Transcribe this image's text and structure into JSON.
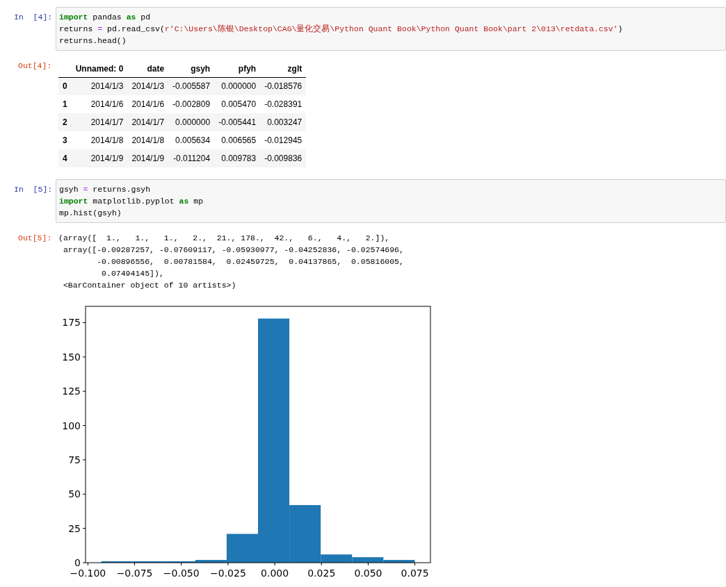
{
  "cells": [
    {
      "in_prompt": "In  [4]:",
      "code": [
        [
          {
            "kind": "keyword",
            "text": "import"
          },
          {
            "kind": "plain",
            "text": " pandas "
          },
          {
            "kind": "keyword",
            "text": "as"
          },
          {
            "kind": "plain",
            "text": " pd"
          }
        ],
        [
          {
            "kind": "plain",
            "text": "returns "
          },
          {
            "kind": "operator",
            "text": "="
          },
          {
            "kind": "plain",
            "text": " pd.read_csv("
          },
          {
            "kind": "string",
            "text": "r'C:\\Users\\陈银\\Desktop\\CAG\\量化交易\\Python Quant Book\\Python Quant Book\\part 2\\013\\retdata.csv'"
          },
          {
            "kind": "plain",
            "text": ")"
          }
        ],
        [
          {
            "kind": "plain",
            "text": "returns.head()"
          }
        ]
      ],
      "out_prompt": "Out[4]:",
      "output": {
        "kind": "table",
        "columns": [
          "",
          "Unnamed: 0",
          "date",
          "gsyh",
          "pfyh",
          "zglt"
        ],
        "rows": [
          [
            "0",
            "2014/1/3",
            "2014/1/3",
            "-0.005587",
            "0.000000",
            "-0.018576"
          ],
          [
            "1",
            "2014/1/6",
            "2014/1/6",
            "-0.002809",
            "0.005470",
            "-0.028391"
          ],
          [
            "2",
            "2014/1/7",
            "2014/1/7",
            "0.000000",
            "-0.005441",
            "0.003247"
          ],
          [
            "3",
            "2014/1/8",
            "2014/1/8",
            "0.005634",
            "0.006565",
            "-0.012945"
          ],
          [
            "4",
            "2014/1/9",
            "2014/1/9",
            "-0.011204",
            "0.009783",
            "-0.009836"
          ]
        ]
      }
    },
    {
      "in_prompt": "In  [5]:",
      "code": [
        [
          {
            "kind": "plain",
            "text": "gsyh "
          },
          {
            "kind": "operator",
            "text": "="
          },
          {
            "kind": "plain",
            "text": " returns.gsyh"
          }
        ],
        [
          {
            "kind": "keyword",
            "text": "import"
          },
          {
            "kind": "plain",
            "text": " matplotlib.pyplot "
          },
          {
            "kind": "keyword",
            "text": "as"
          },
          {
            "kind": "plain",
            "text": " mp"
          }
        ],
        [
          {
            "kind": "plain",
            "text": "mp.hist(gsyh)"
          }
        ]
      ],
      "out_prompt": "Out[5]:",
      "output": {
        "kind": "text",
        "lines": [
          "(array([  1.,   1.,   1.,   2.,  21., 178.,  42.,   6.,   4.,   2.]),",
          " array([-0.09287257, -0.07609117, -0.05930977, -0.04252836, -0.02574696,",
          "        -0.00896556,  0.00781584,  0.02459725,  0.04137865,  0.05816005,",
          "         0.07494145]),",
          " <BarContainer object of 10 artists>)"
        ],
        "chart_data": {
          "type": "bar",
          "x": [
            -0.08448187,
            -0.06770047,
            -0.05091907,
            -0.03413766,
            -0.01735626,
            -0.00057486,
            0.01620654,
            0.03298795,
            0.04976935,
            0.06655075
          ],
          "series": [
            {
              "color": "#1f77b4",
              "values": [
                1,
                1,
                1,
                2,
                21,
                178,
                42,
                6,
                4,
                2
              ]
            }
          ],
          "xlim": [
            -0.10126,
            0.08333
          ],
          "ylim": [
            0,
            186.9
          ],
          "xticks": [
            {
              "value": -0.1,
              "label": "−0.100"
            },
            {
              "value": -0.075,
              "label": "−0.075"
            },
            {
              "value": -0.05,
              "label": "−0.050"
            },
            {
              "value": -0.025,
              "label": "−0.025"
            },
            {
              "value": 0,
              "label": "0.000"
            },
            {
              "value": 0.025,
              "label": "0.025"
            },
            {
              "value": 0.05,
              "label": "0.050"
            },
            {
              "value": 0.075,
              "label": "0.075"
            }
          ],
          "yticks": [
            0,
            25,
            50,
            75,
            100,
            125,
            150,
            175
          ]
        }
      }
    }
  ]
}
